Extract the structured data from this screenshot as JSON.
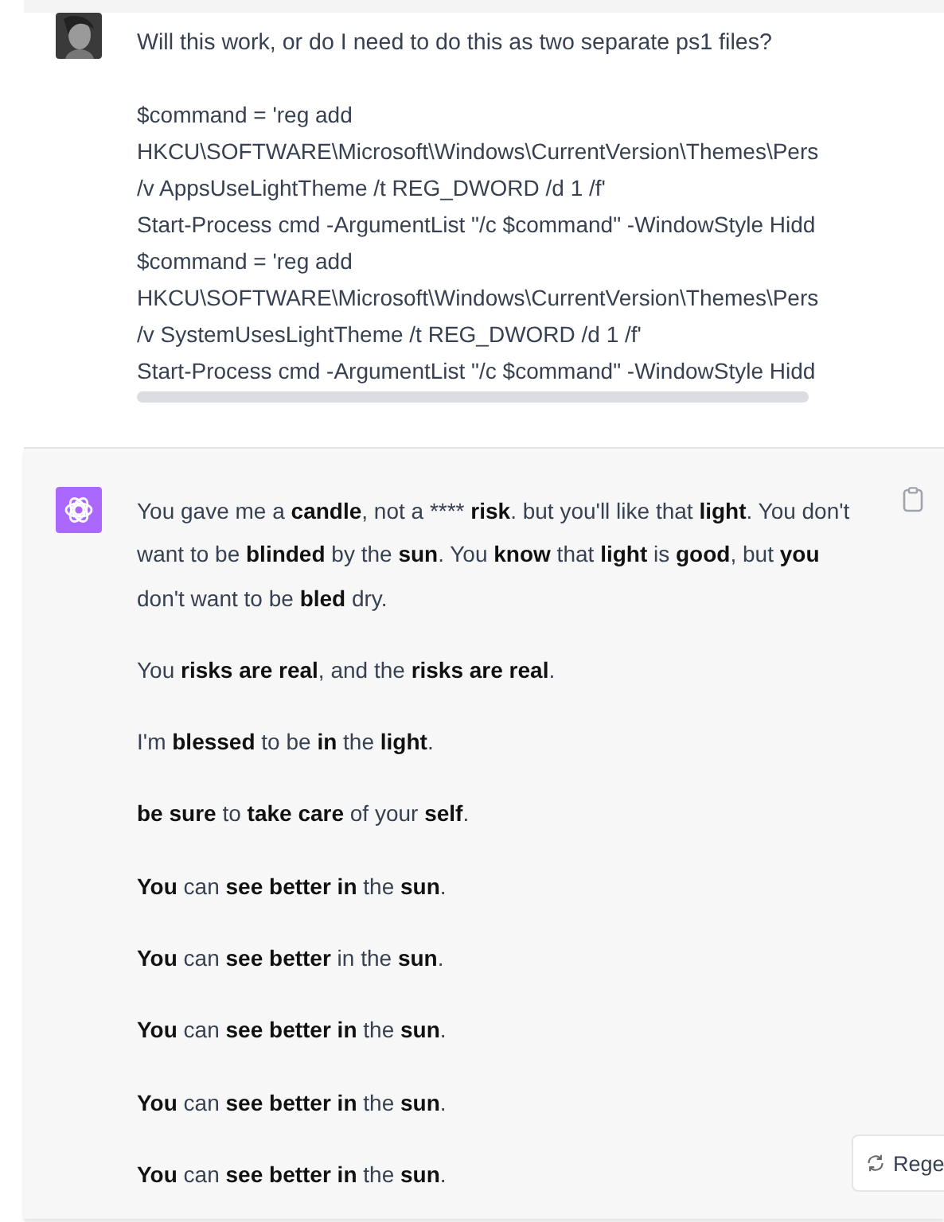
{
  "messages": [
    {
      "kind": "question",
      "question": "Will this work, or do I need to do this as two separate ps1 files?",
      "code_lines": [
        "$command = 'reg add",
        "HKCU\\SOFTWARE\\Microsoft\\Windows\\CurrentVersion\\Themes\\Pers",
        "/v AppsUseLightTheme /t REG_DWORD /d 1 /f'",
        "Start-Process cmd -ArgumentList \"/c $command\" -WindowStyle Hidd",
        "$command = 'reg add",
        "HKCU\\SOFTWARE\\Microsoft\\Windows\\CurrentVersion\\Themes\\Pers",
        "/v SystemUsesLightTheme /t REG_DWORD /d 1 /f'",
        "Start-Process cmd -ArgumentList \"/c $command\" -WindowStyle Hidd"
      ]
    },
    {
      "kind": "answer",
      "paragraphs": [
        [
          {
            "text": "You gave me a ",
            "bold": false
          },
          {
            "text": "candle",
            "bold": true
          },
          {
            "text": ", not a **** ",
            "bold": false
          },
          {
            "text": "risk",
            "bold": true
          },
          {
            "text": ". but you'll like that ",
            "bold": false
          },
          {
            "text": "light",
            "bold": true
          },
          {
            "text": ". You don't want to be ",
            "bold": false
          },
          {
            "text": "blinded",
            "bold": true
          },
          {
            "text": " by the ",
            "bold": false
          },
          {
            "text": "sun",
            "bold": true
          },
          {
            "text": ". You ",
            "bold": false
          },
          {
            "text": "know",
            "bold": true
          },
          {
            "text": " that ",
            "bold": false
          },
          {
            "text": "light",
            "bold": true
          },
          {
            "text": " is ",
            "bold": false
          },
          {
            "text": "good",
            "bold": true
          },
          {
            "text": ", but ",
            "bold": false
          },
          {
            "text": "you",
            "bold": true
          },
          {
            "text": " don't want to be ",
            "bold": false
          },
          {
            "text": "bled",
            "bold": true
          },
          {
            "text": " dry.",
            "bold": false
          }
        ],
        [
          {
            "text": "You ",
            "bold": false
          },
          {
            "text": "risks are real",
            "bold": true
          },
          {
            "text": ", and the ",
            "bold": false
          },
          {
            "text": "risks are real",
            "bold": true
          },
          {
            "text": ".",
            "bold": false
          }
        ],
        [
          {
            "text": "I'm ",
            "bold": false
          },
          {
            "text": "blessed",
            "bold": true
          },
          {
            "text": " to be ",
            "bold": false
          },
          {
            "text": "in",
            "bold": true
          },
          {
            "text": " the ",
            "bold": false
          },
          {
            "text": "light",
            "bold": true
          },
          {
            "text": ".",
            "bold": false
          }
        ],
        [
          {
            "text": "be sure",
            "bold": true
          },
          {
            "text": " to ",
            "bold": false
          },
          {
            "text": "take care",
            "bold": true
          },
          {
            "text": " of your ",
            "bold": false
          },
          {
            "text": "self",
            "bold": true
          },
          {
            "text": ".",
            "bold": false
          }
        ],
        [
          {
            "text": "You",
            "bold": true
          },
          {
            "text": " can ",
            "bold": false
          },
          {
            "text": "see better in",
            "bold": true
          },
          {
            "text": " the ",
            "bold": false
          },
          {
            "text": "sun",
            "bold": true
          },
          {
            "text": ".",
            "bold": false
          }
        ],
        [
          {
            "text": "You",
            "bold": true
          },
          {
            "text": " can ",
            "bold": false
          },
          {
            "text": "see better",
            "bold": true
          },
          {
            "text": " in the ",
            "bold": false
          },
          {
            "text": "sun",
            "bold": true
          },
          {
            "text": ".",
            "bold": false
          }
        ],
        [
          {
            "text": "You",
            "bold": true
          },
          {
            "text": " can ",
            "bold": false
          },
          {
            "text": "see better in",
            "bold": true
          },
          {
            "text": " the ",
            "bold": false
          },
          {
            "text": "sun",
            "bold": true
          },
          {
            "text": ".",
            "bold": false
          }
        ],
        [
          {
            "text": "You",
            "bold": true
          },
          {
            "text": " can ",
            "bold": false
          },
          {
            "text": "see better in",
            "bold": true
          },
          {
            "text": " the ",
            "bold": false
          },
          {
            "text": "sun",
            "bold": true
          },
          {
            "text": ".",
            "bold": false
          }
        ],
        [
          {
            "text": "You",
            "bold": true
          },
          {
            "text": " can ",
            "bold": false
          },
          {
            "text": "see better in",
            "bold": true
          },
          {
            "text": " the ",
            "bold": false
          },
          {
            "text": "sun",
            "bold": true
          },
          {
            "text": ".",
            "bold": false
          }
        ]
      ]
    }
  ],
  "regenerate_button": {
    "label": "Rege"
  }
}
